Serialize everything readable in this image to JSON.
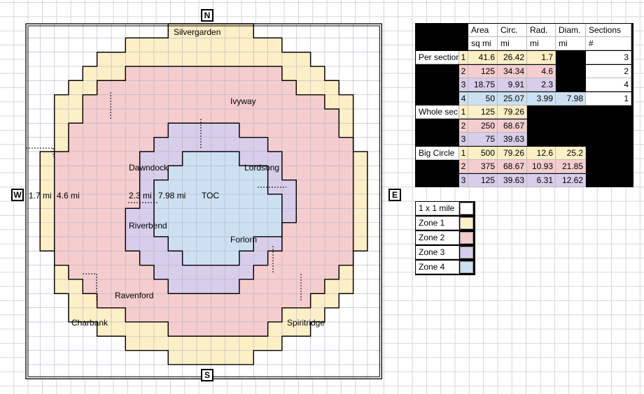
{
  "compass": {
    "north": "N",
    "south": "S",
    "east": "E",
    "west": "W"
  },
  "colors": {
    "zone1": "#fdefc6",
    "zone2": "#f5cdce",
    "zone3": "#d8cdea",
    "zone4": "#cde0f2",
    "grid": "#d6d6d6",
    "map_grid": "#b4b4c8"
  },
  "map": {
    "places": {
      "silvergarden": "Silvergarden",
      "ivyway": "Ivyway",
      "dawndock": "Dawndock",
      "lordsong": "Lordsong",
      "toc": "TOC",
      "riverbend": "Riverbend",
      "forlorn": "Forlorn",
      "ravenford": "Ravenford",
      "charbank": "Charbank",
      "spiritridge": "Spiritridge"
    },
    "distances": {
      "d1": "1.7 mi",
      "d2": "4.6 mi",
      "d3": "2.3 mi",
      "d4": "7.98 mi"
    }
  },
  "stats": {
    "headers": [
      "Area",
      "Circ.",
      "Rad.",
      "Diam.",
      "Sections"
    ],
    "units": [
      "sq mi",
      "mi",
      "mi",
      "mi",
      "#"
    ],
    "groups": [
      {
        "label": "Per section",
        "rows": [
          {
            "zone": "1",
            "area": "41.6",
            "circ": "26.42",
            "rad": "1.7",
            "diam": "",
            "sections": "3"
          },
          {
            "zone": "2",
            "area": "125",
            "circ": "34.34",
            "rad": "4.6",
            "diam": "",
            "sections": "2"
          },
          {
            "zone": "3",
            "area": "18.75",
            "circ": "9.91",
            "rad": "2.3",
            "diam": "",
            "sections": "4"
          },
          {
            "zone": "4",
            "area": "50",
            "circ": "25.07",
            "rad": "3.99",
            "diam": "7.98",
            "sections": "1"
          }
        ]
      },
      {
        "label": "Whole sec.",
        "rows": [
          {
            "zone": "1",
            "area": "125",
            "circ": "79.26",
            "rad": "",
            "diam": "",
            "sections": ""
          },
          {
            "zone": "2",
            "area": "250",
            "circ": "68.67",
            "rad": "",
            "diam": "",
            "sections": ""
          },
          {
            "zone": "3",
            "area": "75",
            "circ": "39.63",
            "rad": "",
            "diam": "",
            "sections": ""
          }
        ]
      },
      {
        "label": "Big Circle",
        "rows": [
          {
            "zone": "1",
            "area": "500",
            "circ": "79.26",
            "rad": "12.6",
            "diam": "25.2",
            "sections": ""
          },
          {
            "zone": "2",
            "area": "375",
            "circ": "68.67",
            "rad": "10.93",
            "diam": "21.85",
            "sections": ""
          },
          {
            "zone": "3",
            "area": "125",
            "circ": "39.63",
            "rad": "6.31",
            "diam": "12.62",
            "sections": ""
          }
        ]
      }
    ]
  },
  "legend": [
    {
      "label": "1 x 1 mile",
      "zone": "none"
    },
    {
      "label": "Zone 1",
      "zone": "1"
    },
    {
      "label": "Zone 2",
      "zone": "2"
    },
    {
      "label": "Zone 3",
      "zone": "3"
    },
    {
      "label": "Zone 4",
      "zone": "4"
    }
  ]
}
